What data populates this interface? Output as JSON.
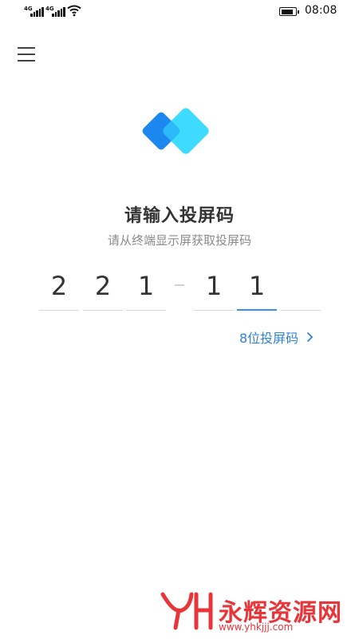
{
  "status_bar": {
    "network_labels": [
      "4G",
      "4G"
    ],
    "time": "08:08",
    "battery_level": 0.85,
    "icons": [
      "signal-icon",
      "signal-icon",
      "wifi-icon",
      "battery-icon"
    ]
  },
  "header": {
    "menu_icon": "menu-icon"
  },
  "main": {
    "logo_icon": "cast-logo-icon",
    "title": "请输入投屏码",
    "subtitle": "请从终端显示屏获取投屏码",
    "code": {
      "digits": [
        "2",
        "2",
        "1",
        "",
        "1",
        "1",
        ""
      ],
      "active_index": 5
    },
    "eight_digit_link": "8位投屏码",
    "chevron_icon": "chevron-right-icon"
  },
  "watermark": {
    "brand_text": "永辉资源网",
    "url": "www.yhkjjj.com"
  },
  "colors": {
    "accent": "#2f82d6",
    "logo_dark": "#1e88f0",
    "logo_light": "#35d8ff",
    "watermark_red": "#e8353a"
  }
}
